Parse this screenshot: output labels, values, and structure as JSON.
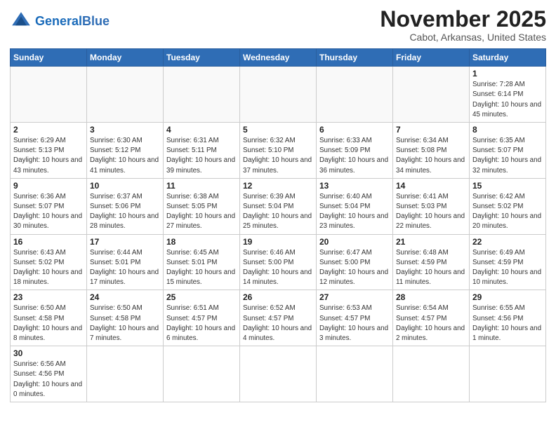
{
  "logo": {
    "general": "General",
    "blue": "Blue"
  },
  "title": "November 2025",
  "subtitle": "Cabot, Arkansas, United States",
  "weekdays": [
    "Sunday",
    "Monday",
    "Tuesday",
    "Wednesday",
    "Thursday",
    "Friday",
    "Saturday"
  ],
  "weeks": [
    [
      {
        "day": null,
        "info": null
      },
      {
        "day": null,
        "info": null
      },
      {
        "day": null,
        "info": null
      },
      {
        "day": null,
        "info": null
      },
      {
        "day": null,
        "info": null
      },
      {
        "day": null,
        "info": null
      },
      {
        "day": "1",
        "info": "Sunrise: 7:28 AM\nSunset: 6:14 PM\nDaylight: 10 hours\nand 45 minutes."
      }
    ],
    [
      {
        "day": "2",
        "info": "Sunrise: 6:29 AM\nSunset: 5:13 PM\nDaylight: 10 hours\nand 43 minutes."
      },
      {
        "day": "3",
        "info": "Sunrise: 6:30 AM\nSunset: 5:12 PM\nDaylight: 10 hours\nand 41 minutes."
      },
      {
        "day": "4",
        "info": "Sunrise: 6:31 AM\nSunset: 5:11 PM\nDaylight: 10 hours\nand 39 minutes."
      },
      {
        "day": "5",
        "info": "Sunrise: 6:32 AM\nSunset: 5:10 PM\nDaylight: 10 hours\nand 37 minutes."
      },
      {
        "day": "6",
        "info": "Sunrise: 6:33 AM\nSunset: 5:09 PM\nDaylight: 10 hours\nand 36 minutes."
      },
      {
        "day": "7",
        "info": "Sunrise: 6:34 AM\nSunset: 5:08 PM\nDaylight: 10 hours\nand 34 minutes."
      },
      {
        "day": "8",
        "info": "Sunrise: 6:35 AM\nSunset: 5:07 PM\nDaylight: 10 hours\nand 32 minutes."
      }
    ],
    [
      {
        "day": "9",
        "info": "Sunrise: 6:36 AM\nSunset: 5:07 PM\nDaylight: 10 hours\nand 30 minutes."
      },
      {
        "day": "10",
        "info": "Sunrise: 6:37 AM\nSunset: 5:06 PM\nDaylight: 10 hours\nand 28 minutes."
      },
      {
        "day": "11",
        "info": "Sunrise: 6:38 AM\nSunset: 5:05 PM\nDaylight: 10 hours\nand 27 minutes."
      },
      {
        "day": "12",
        "info": "Sunrise: 6:39 AM\nSunset: 5:04 PM\nDaylight: 10 hours\nand 25 minutes."
      },
      {
        "day": "13",
        "info": "Sunrise: 6:40 AM\nSunset: 5:04 PM\nDaylight: 10 hours\nand 23 minutes."
      },
      {
        "day": "14",
        "info": "Sunrise: 6:41 AM\nSunset: 5:03 PM\nDaylight: 10 hours\nand 22 minutes."
      },
      {
        "day": "15",
        "info": "Sunrise: 6:42 AM\nSunset: 5:02 PM\nDaylight: 10 hours\nand 20 minutes."
      }
    ],
    [
      {
        "day": "16",
        "info": "Sunrise: 6:43 AM\nSunset: 5:02 PM\nDaylight: 10 hours\nand 18 minutes."
      },
      {
        "day": "17",
        "info": "Sunrise: 6:44 AM\nSunset: 5:01 PM\nDaylight: 10 hours\nand 17 minutes."
      },
      {
        "day": "18",
        "info": "Sunrise: 6:45 AM\nSunset: 5:01 PM\nDaylight: 10 hours\nand 15 minutes."
      },
      {
        "day": "19",
        "info": "Sunrise: 6:46 AM\nSunset: 5:00 PM\nDaylight: 10 hours\nand 14 minutes."
      },
      {
        "day": "20",
        "info": "Sunrise: 6:47 AM\nSunset: 5:00 PM\nDaylight: 10 hours\nand 12 minutes."
      },
      {
        "day": "21",
        "info": "Sunrise: 6:48 AM\nSunset: 4:59 PM\nDaylight: 10 hours\nand 11 minutes."
      },
      {
        "day": "22",
        "info": "Sunrise: 6:49 AM\nSunset: 4:59 PM\nDaylight: 10 hours\nand 10 minutes."
      }
    ],
    [
      {
        "day": "23",
        "info": "Sunrise: 6:50 AM\nSunset: 4:58 PM\nDaylight: 10 hours\nand 8 minutes."
      },
      {
        "day": "24",
        "info": "Sunrise: 6:50 AM\nSunset: 4:58 PM\nDaylight: 10 hours\nand 7 minutes."
      },
      {
        "day": "25",
        "info": "Sunrise: 6:51 AM\nSunset: 4:57 PM\nDaylight: 10 hours\nand 6 minutes."
      },
      {
        "day": "26",
        "info": "Sunrise: 6:52 AM\nSunset: 4:57 PM\nDaylight: 10 hours\nand 4 minutes."
      },
      {
        "day": "27",
        "info": "Sunrise: 6:53 AM\nSunset: 4:57 PM\nDaylight: 10 hours\nand 3 minutes."
      },
      {
        "day": "28",
        "info": "Sunrise: 6:54 AM\nSunset: 4:57 PM\nDaylight: 10 hours\nand 2 minutes."
      },
      {
        "day": "29",
        "info": "Sunrise: 6:55 AM\nSunset: 4:56 PM\nDaylight: 10 hours\nand 1 minute."
      }
    ],
    [
      {
        "day": "30",
        "info": "Sunrise: 6:56 AM\nSunset: 4:56 PM\nDaylight: 10 hours\nand 0 minutes."
      },
      {
        "day": null,
        "info": null
      },
      {
        "day": null,
        "info": null
      },
      {
        "day": null,
        "info": null
      },
      {
        "day": null,
        "info": null
      },
      {
        "day": null,
        "info": null
      },
      {
        "day": null,
        "info": null
      }
    ]
  ]
}
